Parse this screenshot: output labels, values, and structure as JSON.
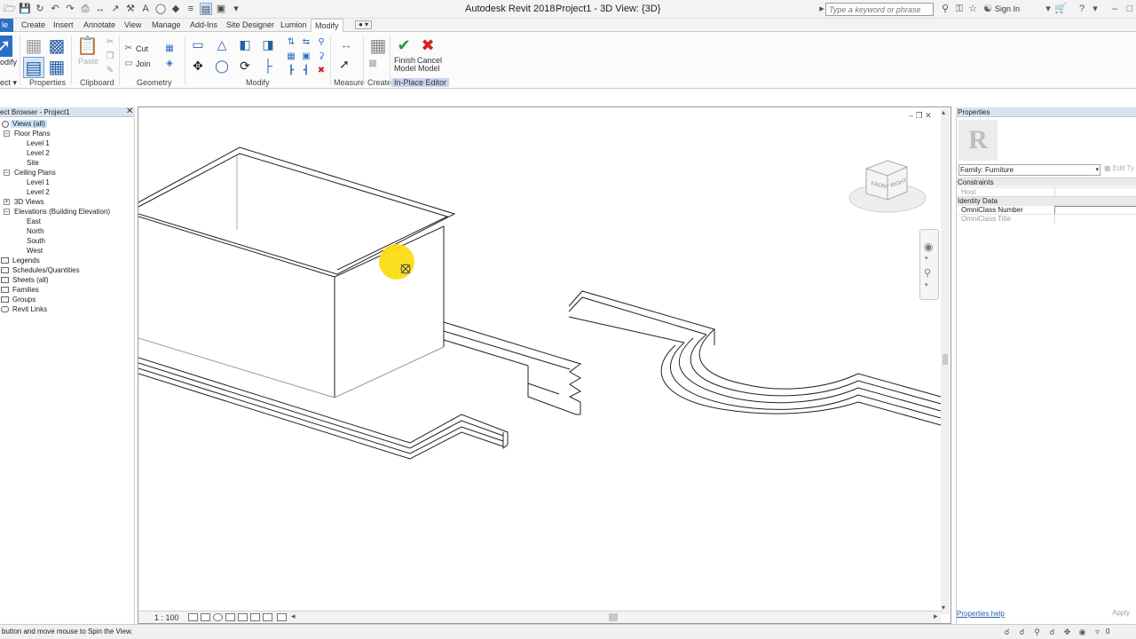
{
  "titlebar": {
    "app_title": "Autodesk Revit 2018 -",
    "view_title": "Project1 - 3D View: {3D}",
    "search_placeholder": "Type a keyword or phrase",
    "sign_in": "Sign In"
  },
  "tabs": [
    {
      "label": "le"
    },
    {
      "label": "Create"
    },
    {
      "label": "Insert"
    },
    {
      "label": "Annotate"
    },
    {
      "label": "View"
    },
    {
      "label": "Manage"
    },
    {
      "label": "Add-Ins"
    },
    {
      "label": "Site Designer"
    },
    {
      "label": "Lumion"
    },
    {
      "label": "Modify"
    }
  ],
  "ribbon": {
    "modify_label": "odify",
    "select_label": "ect ▾",
    "cut_label": "Cut",
    "join_label": "Join",
    "paste_label": "Paste",
    "finish_model": [
      "Finish",
      "Model"
    ],
    "cancel_model": [
      "Cancel",
      "Model"
    ],
    "panels": {
      "properties": "Properties",
      "clipboard": "Clipboard",
      "geometry": "Geometry",
      "modify": "Modify",
      "measure": "Measure",
      "create": "Create",
      "inplace_editor": "In-Place Editor"
    }
  },
  "project_browser": {
    "title": "ect Browser - Project1",
    "items": [
      {
        "label": "Views (all)"
      },
      {
        "label": "Floor Plans"
      },
      {
        "label": "Level 1"
      },
      {
        "label": "Level 2"
      },
      {
        "label": "Site"
      },
      {
        "label": "Ceiling Plans"
      },
      {
        "label": "Level 1"
      },
      {
        "label": "Level 2"
      },
      {
        "label": "3D Views"
      },
      {
        "label": "Elevations (Building Elevation)"
      },
      {
        "label": "East"
      },
      {
        "label": "North"
      },
      {
        "label": "South"
      },
      {
        "label": "West"
      },
      {
        "label": "Legends"
      },
      {
        "label": "Schedules/Quantities"
      },
      {
        "label": "Sheets (all)"
      },
      {
        "label": "Families"
      },
      {
        "label": "Groups"
      },
      {
        "label": "Revit Links"
      }
    ]
  },
  "viewport": {
    "scale": "1 : 100",
    "viewcube_front": "FRONT",
    "viewcube_right": "RIGHT"
  },
  "properties": {
    "title": "Properties",
    "family": "Family: Furniture",
    "edit_type": "Edit Ty",
    "groups": [
      {
        "name": "Constraints",
        "rows": [
          {
            "name": "Host",
            "value": ""
          }
        ]
      },
      {
        "name": "Identity Data",
        "rows": [
          {
            "name": "OmniClass Number",
            "value": ""
          },
          {
            "name": "OmniClass Title",
            "value": ""
          }
        ]
      }
    ],
    "help": "Properties help",
    "apply": "Apply"
  },
  "statusbar": {
    "text": "button and move mouse to Spin the View.",
    "count": "0"
  }
}
